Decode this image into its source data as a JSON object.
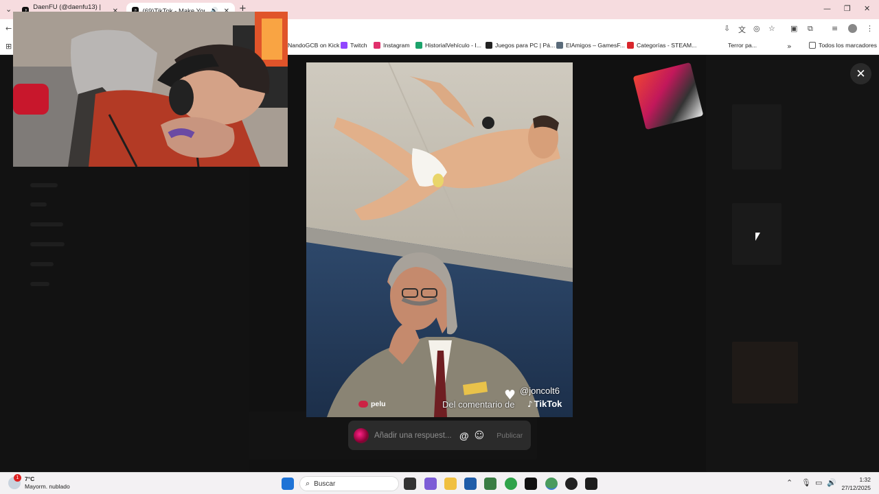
{
  "browser": {
    "tabs": [
      {
        "title": "DaenFU (@daenfu13) | TikTok",
        "active": false
      },
      {
        "title": "(69)TikTok - Make Your Day",
        "active": true
      }
    ],
    "new_tab": "+",
    "bookmarks": [
      {
        "label": "NandoGCB on Kick",
        "color": "#53fc18"
      },
      {
        "label": "Twitch",
        "color": "#9146ff"
      },
      {
        "label": "Instagram",
        "color": "#e1306c"
      },
      {
        "label": "HistorialVehículo - I...",
        "color": "#1ca36b"
      },
      {
        "label": "Juegos para PC | Pá...",
        "color": "#222222"
      },
      {
        "label": "ElAmigos – GamesF...",
        "color": "#5a6b7a"
      },
      {
        "label": "Categorías - STEAM...",
        "color": "#d9262c"
      },
      {
        "label": "Terror pa...",
        "color": "#444444"
      }
    ],
    "all_bookmarks": "Todos los marcadores"
  },
  "overlay": {
    "close_label": "✕",
    "watermark_handle": "@joncolt6",
    "watermark_brand": "TikTok",
    "comment_caption": "Del comentario de",
    "comment_user": "pelu",
    "reply": {
      "placeholder": "Añadir una respuest...",
      "mention": "@",
      "emoji": "☺",
      "publish": "Publicar"
    }
  },
  "taskbar": {
    "weather_temp": "7°C",
    "weather_desc": "Mayorm. nublado",
    "weather_badge": "1",
    "search_label": "Buscar",
    "time": "1:32",
    "date": "27/12/2025"
  }
}
